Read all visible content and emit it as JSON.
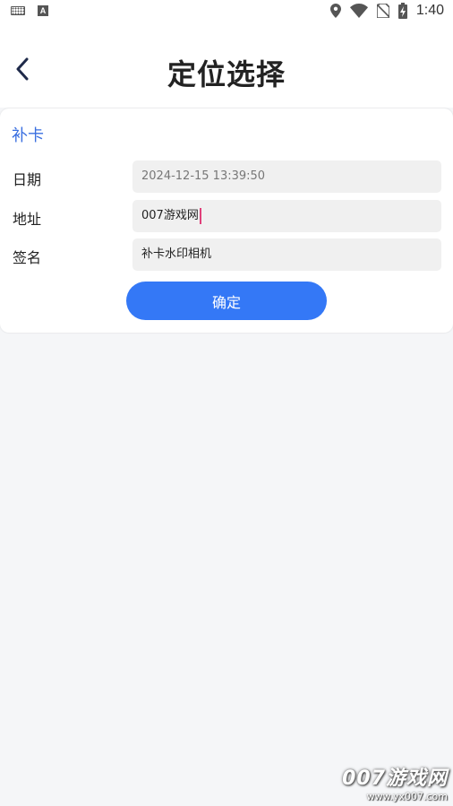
{
  "status_bar": {
    "time": "1:40",
    "icons": [
      "keyboard-icon",
      "a-badge-icon",
      "location-icon",
      "wifi-icon",
      "no-sim-icon",
      "battery-charging-icon"
    ]
  },
  "header": {
    "title": "定位选择",
    "back_icon": "chevron-left-icon"
  },
  "card": {
    "title": "补卡",
    "fields": [
      {
        "label": "日期",
        "value": "2024-12-15 13:39:50"
      },
      {
        "label": "地址",
        "value": "007游戏网"
      },
      {
        "label": "签名",
        "value": "补卡水印相机"
      }
    ],
    "confirm_label": "确定"
  },
  "watermark": {
    "main": "007游戏网",
    "url": "www.yx007.com"
  },
  "colors": {
    "accent": "#3478f6",
    "card_title": "#3a6fe0",
    "cursor": "#e0407a"
  }
}
